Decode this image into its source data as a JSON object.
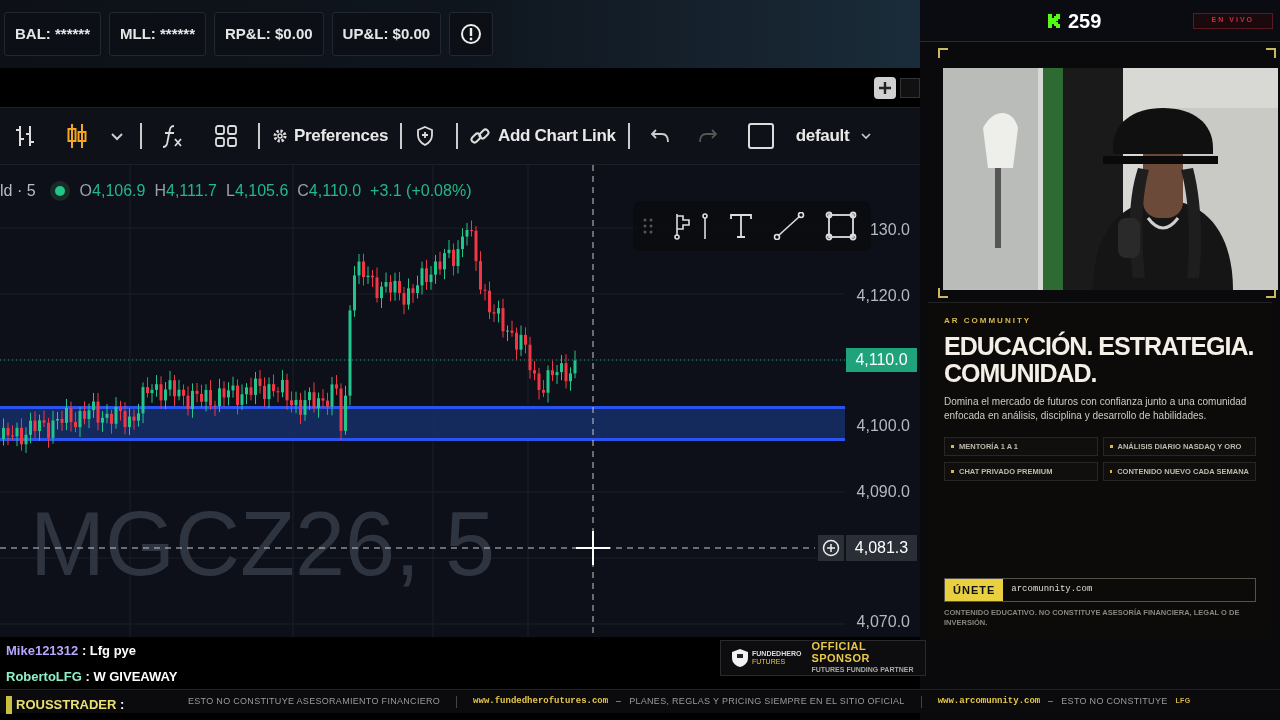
{
  "account_stats": [
    {
      "label": "BAL: ******"
    },
    {
      "label": "MLL: ******"
    },
    {
      "label": "RP&L: $0.00"
    },
    {
      "label": "UP&L: $0.00"
    }
  ],
  "toolbar": {
    "preferences": "Preferences",
    "chart_link": "Add Chart Link",
    "checked": false,
    "layout": "default"
  },
  "chart": {
    "symbol": "ld · 5",
    "ohlc": [
      {
        "label": "O",
        "value": "4,106.9"
      },
      {
        "label": "H",
        "value": "4,111.7"
      },
      {
        "label": "L",
        "value": "4,105.6"
      },
      {
        "label": "C",
        "value": "4,110.0"
      }
    ],
    "change": "+3.1 (+0.08%)",
    "price_labels": [
      "130.0",
      "4,120.0",
      "4,100.0",
      "4,090.0",
      "4,070.0"
    ],
    "last_price": "4,110.0",
    "crosshair_price": "4,081.3",
    "watermark": "MGCZ26, 5"
  },
  "chat": [
    {
      "user": "Mike121312",
      "color": "#b9a6ff",
      "text": ": Lfg pye",
      "highlighted": false
    },
    {
      "user": "RobertoLFG",
      "color": "#8ef0c8",
      "text": ": W GIVEAWAY",
      "highlighted": false
    },
    {
      "user": "ROUSSTRADER",
      "color": "#e8e070",
      "text": ":",
      "highlighted": true
    }
  ],
  "sponsor": {
    "logo_top": "FUNDEDHERO",
    "logo_bottom": "FUTURES",
    "title": "OFFICIAL SPONSOR",
    "subtitle": "FUTURES FUNDING PARTNER"
  },
  "stream": {
    "viewers": "259",
    "live_badge": "EN VIVO"
  },
  "community": {
    "eyebrow": "AR COMMUNITY",
    "headline": [
      "EDUCACIÓN. ESTRATEGIA.",
      "COMUNIDAD."
    ],
    "description": "Domina el mercado de futuros con confianza junto a una comunidad enfocada en análisis, disciplina y desarrollo de habilidades.",
    "features": [
      "MENTORÍA 1 A 1",
      "ANÁLISIS DIARIO NASDAQ Y ORO",
      "CHAT PRIVADO PREMIUM",
      "CONTENIDO NUEVO CADA SEMANA"
    ],
    "cta": "ÚNETE",
    "url": "arcomunnity.com",
    "disclaimer": "CONTENIDO EDUCATIVO. NO CONSTITUYE ASESORÍA FINANCIERA, LEGAL O DE INVERSIÓN."
  },
  "ticker": [
    {
      "kind": "text",
      "text": "ESTO NO CONSTITUYE ASESORAMIENTO FINANCIERO"
    },
    {
      "kind": "divider"
    },
    {
      "kind": "link",
      "text": "www.fundedherofutures.com"
    },
    {
      "kind": "dash"
    },
    {
      "kind": "text",
      "text": "PLANES, REGLAS Y PRICING SIEMPRE EN EL SITIO OFICIAL"
    },
    {
      "kind": "divider"
    },
    {
      "kind": "link",
      "text": "www.arcomunnity.com"
    },
    {
      "kind": "dash"
    },
    {
      "kind": "text",
      "text": "ESTO NO CONSTITUYE"
    },
    {
      "kind": "tag",
      "text": "LFG"
    }
  ]
}
